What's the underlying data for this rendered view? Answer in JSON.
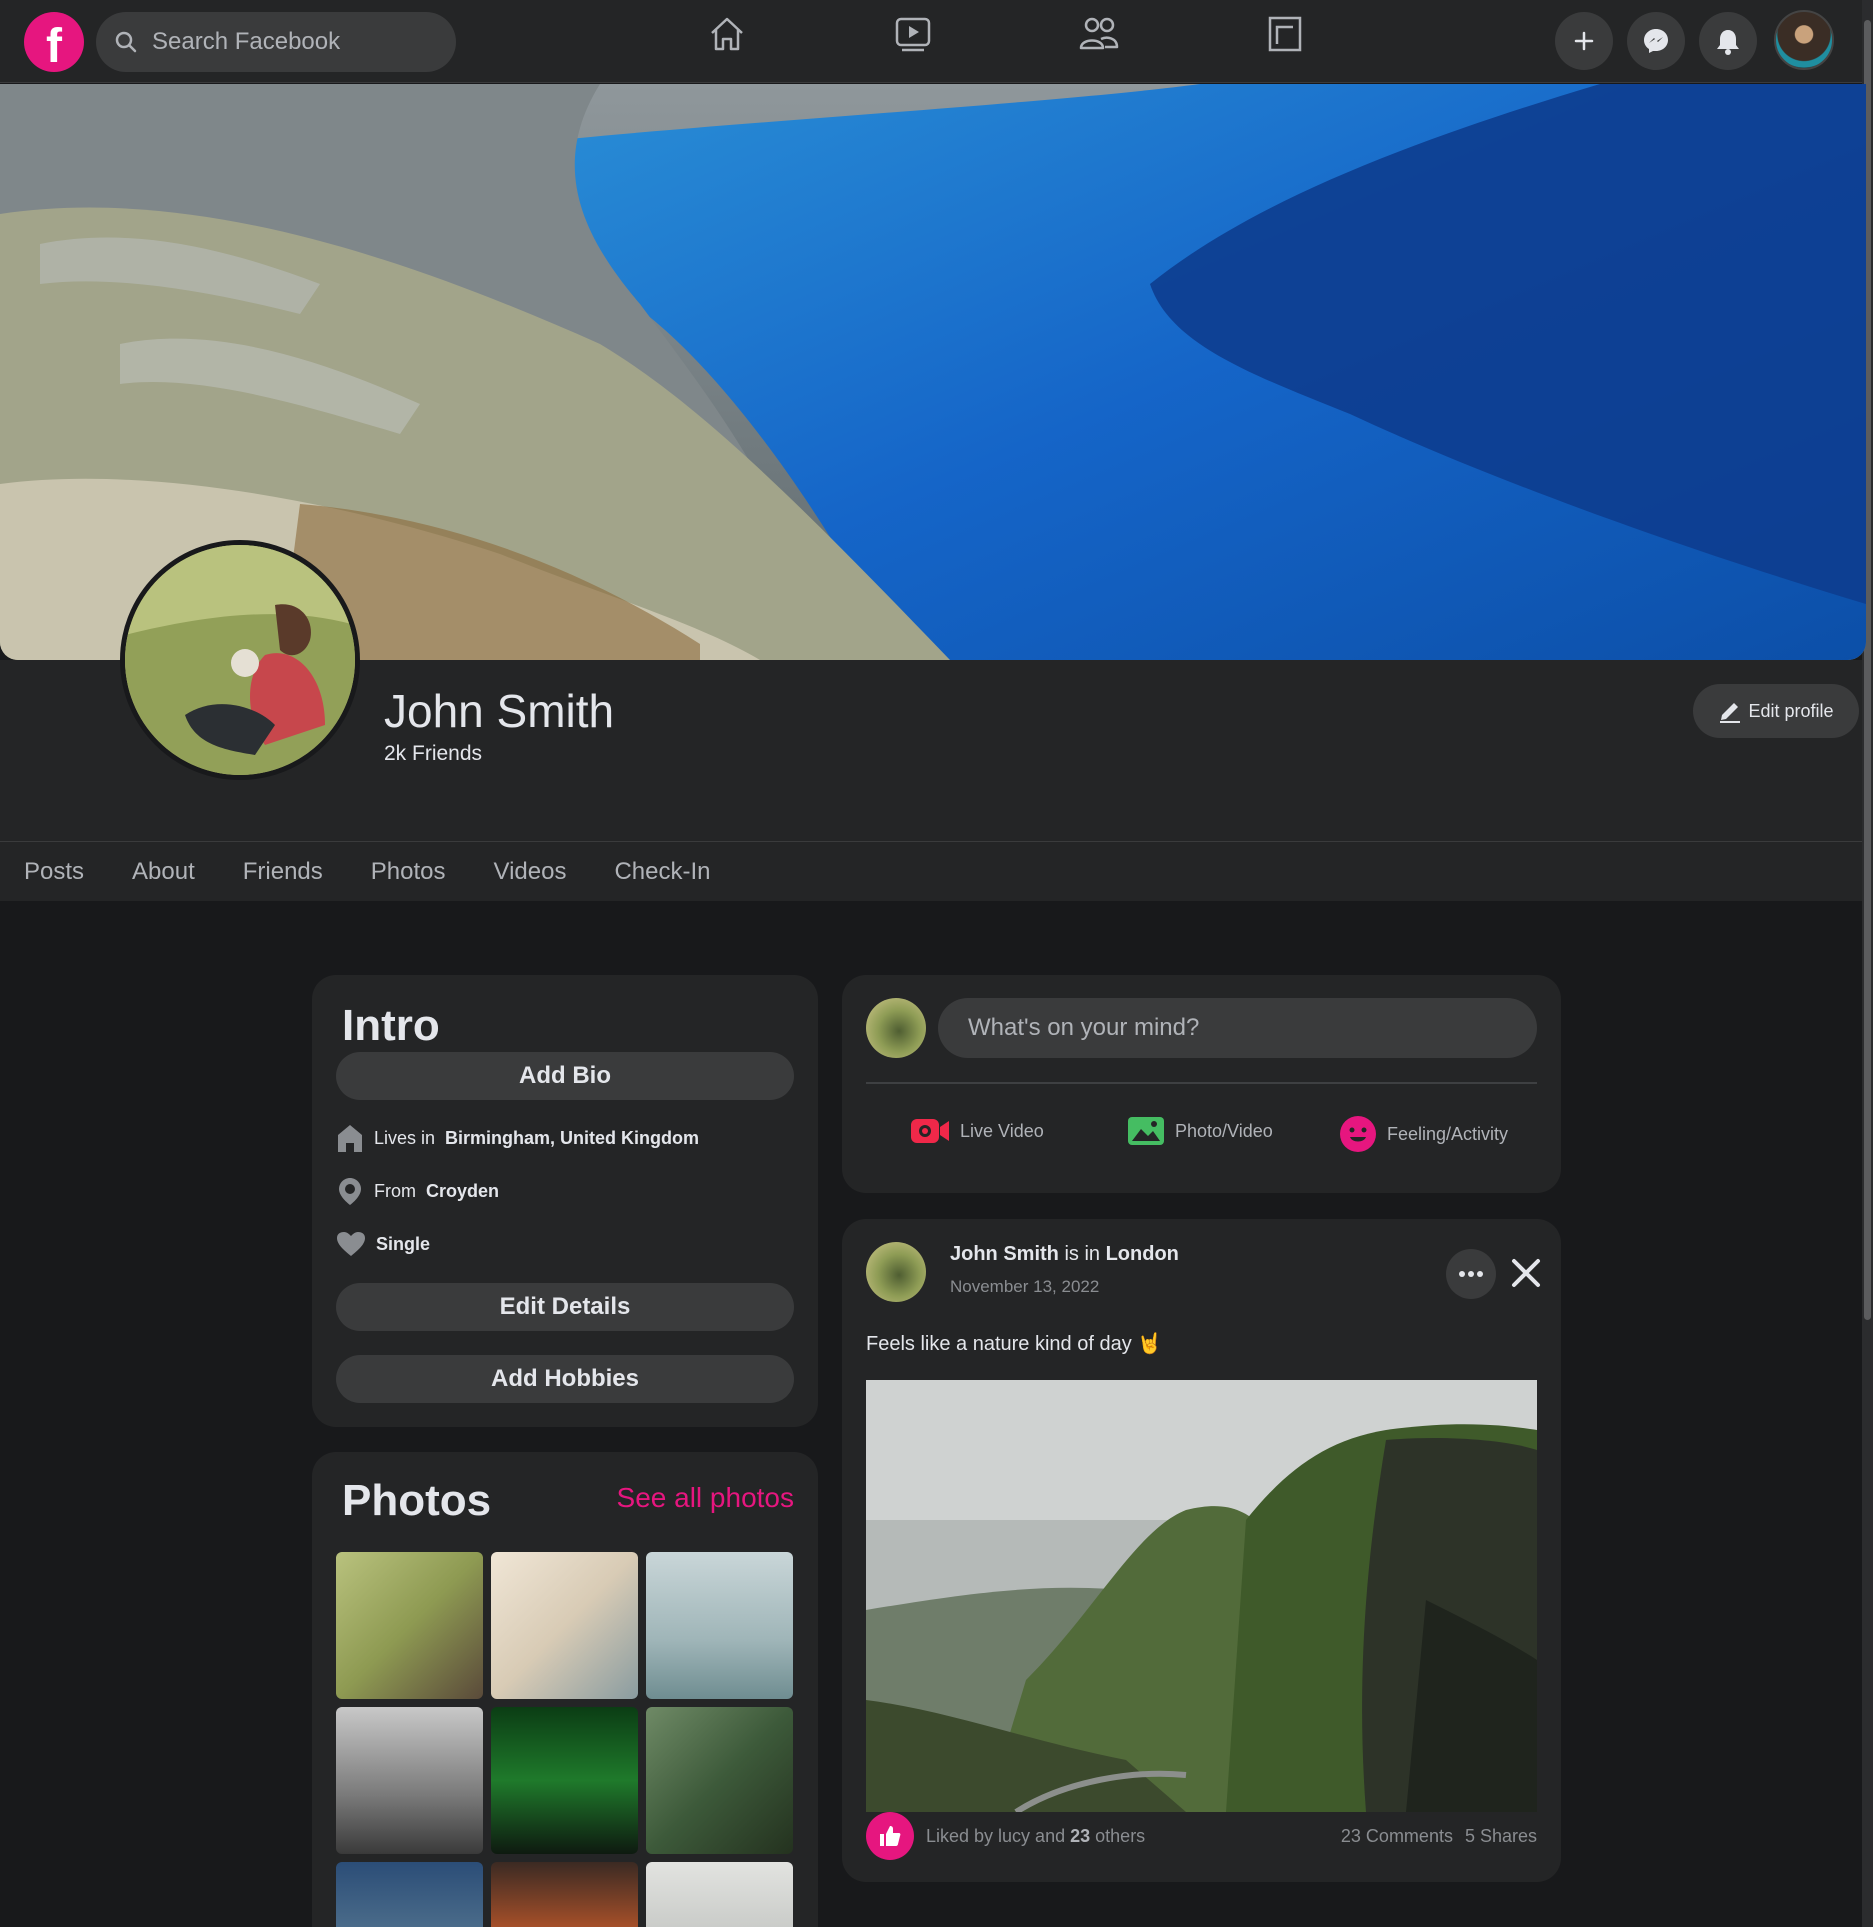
{
  "topbar": {
    "logo_letter": "f",
    "search_placeholder": "Search Facebook",
    "nav": [
      "home-icon",
      "watch-icon",
      "friends-icon",
      "pages-icon"
    ],
    "actions": [
      "plus-icon",
      "messenger-icon",
      "bell-icon"
    ]
  },
  "profile": {
    "name": "John Smith",
    "friends": "2k Friends",
    "edit_label": "Edit profile"
  },
  "tabs": [
    "Posts",
    "About",
    "Friends",
    "Photos",
    "Videos",
    "Check-In"
  ],
  "intro": {
    "title": "Intro",
    "add_bio": "Add Bio",
    "lives_prefix": "Lives in",
    "lives_value": "Birmingham, United Kingdom",
    "from_prefix": "From",
    "from_value": "Croyden",
    "relationship": "Single",
    "edit_details": "Edit Details",
    "add_hobbies": "Add Hobbies"
  },
  "photos": {
    "title": "Photos",
    "see_all": "See all photos",
    "thumb_colors": [
      "#8e9a52",
      "#d8cbb5",
      "#9fb5b8",
      "#7a7a7a",
      "#1f7a2b",
      "#3d5a3a",
      "#4e6f8c",
      "#b3542a",
      "#c7c9c6"
    ]
  },
  "composer": {
    "placeholder": "What's on your mind?",
    "live_label": "Live Video",
    "photo_label": "Photo/Video",
    "feeling_label": "Feeling/Activity"
  },
  "post": {
    "author": "John Smith",
    "is_in": "is in",
    "location": "London",
    "date": "November 13, 2022",
    "text": "Feels like a nature kind of day",
    "emoji": "🤘",
    "liked_prefix": "Liked by lucy and",
    "liked_count": "23",
    "liked_suffix": "others",
    "comments": "23 Comments",
    "shares": "5 Shares"
  },
  "colors": {
    "accent": "#e6167f",
    "background": "#18191b",
    "surface": "#242526",
    "live": "#f02849",
    "photo": "#45bd62"
  }
}
